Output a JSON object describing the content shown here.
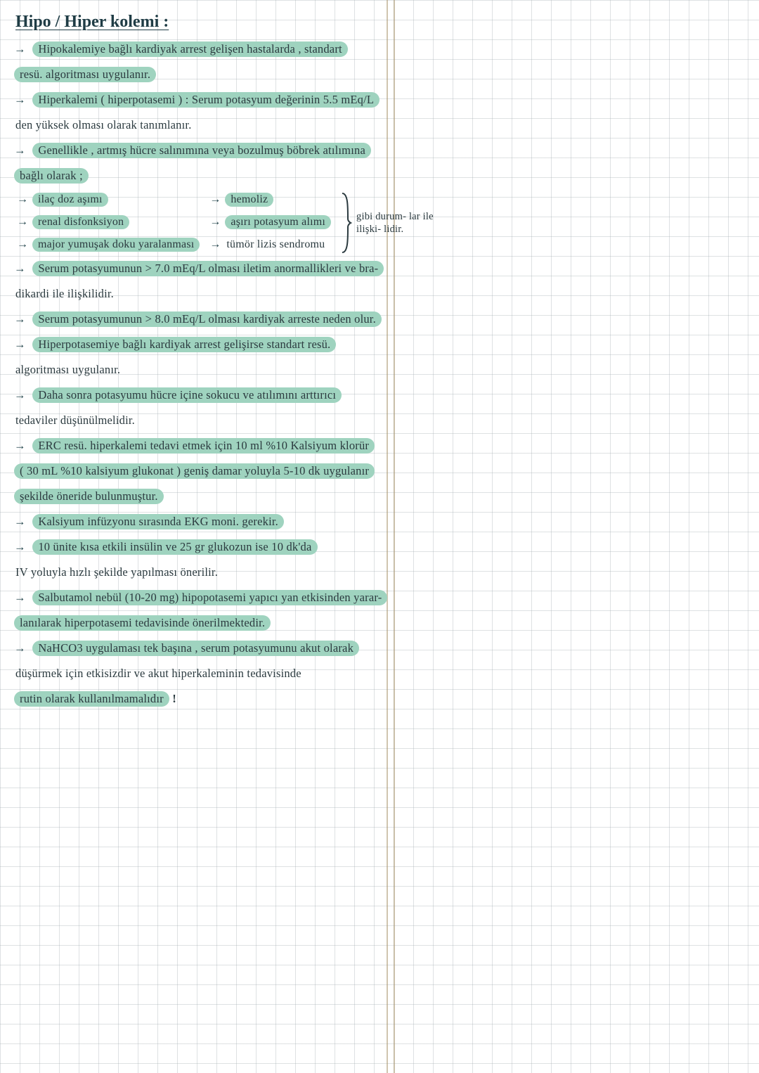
{
  "title": "Hipo / Hiper kolemi :",
  "lines": {
    "l1a": "Hipokalemiye bağlı kardiyak arrest gelişen hastalarda , standart",
    "l1b": "resü. algoritması uygulanır.",
    "l2a": "Hiperkalemi ( hiperpotasemi ) : Serum potasyum değerinin 5.5 mEq/L",
    "l2b": "den yüksek olması olarak tanımlanır.",
    "l3a": "Genellikle , artmış hücre salınımına veya bozulmuş böbrek atılımına",
    "l3b": "bağlı olarak ;",
    "l4_after": "gibi durumlar ile ilişkilidir.",
    "l5a": "Serum potasyumunun > 7.0 mEq/L olması iletim anormallikleri ve bra-",
    "l5b": "dikardi ile ilişkilidir.",
    "l6": "Serum potasyumunun > 8.0 mEq/L olması kardiyak arreste neden olur.",
    "l7a": "Hiperpotasemiye bağlı kardiyak arrest gelişirse standart resü.",
    "l7b": "algoritması uygulanır.",
    "l8a": "Daha sonra potasyumu hücre içine sokucu ve atılımını arttırıcı",
    "l8b": "tedaviler düşünülmelidir.",
    "l9a": "ERC resü. hiperkalemi tedavi etmek için 10 ml %10 Kalsiyum klorür",
    "l9b": "( 30 mL %10 kalsiyum glukonat ) geniş damar yoluyla 5-10 dk uygulanır",
    "l9c": "şekilde öneride bulunmuştur.",
    "l10": "Kalsiyum infüzyonu sırasında EKG moni. gerekir.",
    "l11a": "10 ünite kısa etkili insülin ve 25 gr glukozun ise 10 dk'da",
    "l11b": "IV yoluyla hızlı şekilde yapılması önerilir.",
    "l12a": "Salbutamol nebül (10-20 mg) hipopotasemi yapıcı yan etkisinden yarar-",
    "l12b": "lanılarak hiperpotasemi tedavisinde önerilmektedir.",
    "l13a": "NaHCO3 uygulaması tek başına , serum potasyumunu akut olarak",
    "l13b": "düşürmek için etkisizdir ve akut hiperkaleminin tedavisinde",
    "l13c": "rutin olarak kullanılmamalıdır"
  },
  "sub_left": {
    "a": "ilaç doz aşımı",
    "b": "renal disfonksiyon",
    "c": "major yumuşak doku yaralanması"
  },
  "sub_right": {
    "a": "hemoliz",
    "b": "aşırı potasyum alımı",
    "c": "tümör lizis sendromu"
  },
  "brace_note": "gibi durum- lar ile ilişki- lidir.",
  "exclaim": "!"
}
